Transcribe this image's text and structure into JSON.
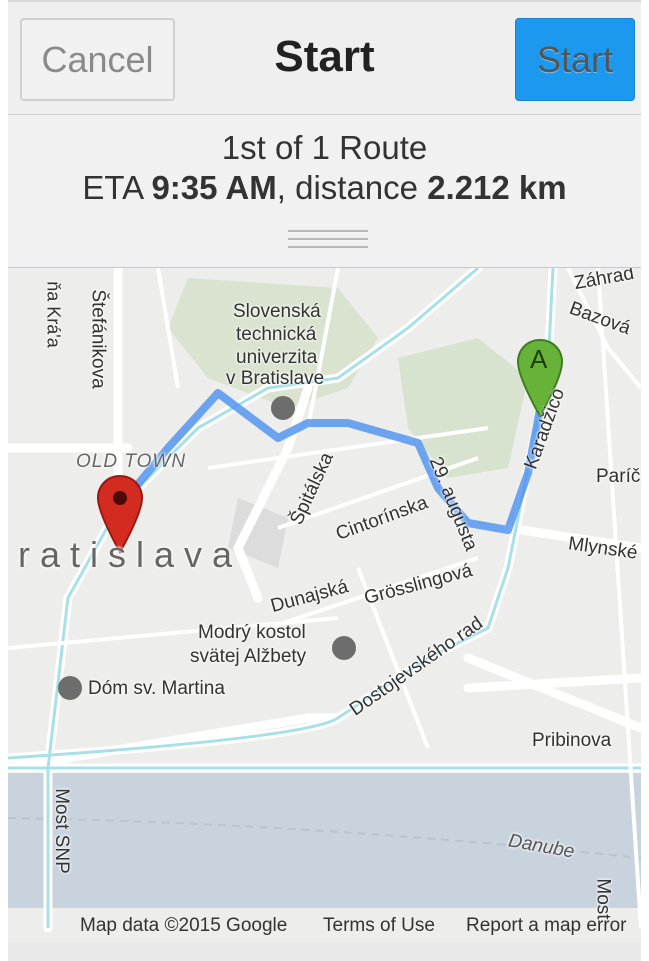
{
  "nav": {
    "cancel_label": "Cancel",
    "title": "Start",
    "start_label": "Start"
  },
  "route": {
    "count_text": "1st of 1 Route",
    "eta_prefix": "ETA ",
    "eta_value": "9:35 AM",
    "distance_prefix": ", distance ",
    "distance_value": "2.212 km"
  },
  "map": {
    "labels": {
      "stu": "Slovenská",
      "stu2": "technická",
      "stu3": "univerzita",
      "stu4": "v Bratislave",
      "old_town": "OLD TOWN",
      "bratislava": "ratislava",
      "stefanikova": "Štefánikova",
      "kraja": "ňa Krá'a",
      "spitalska": "Špitálska",
      "cintorinska": "Cintorínska",
      "augusta": "29. augusta",
      "karadzicova": "Karadžico",
      "dunajska": "Dunajská",
      "grosslingova": "Grösslingová",
      "modry": "Modrý kostol",
      "modry2": "svätej Alžbety",
      "dom": "Dóm sv. Martina",
      "dostojevskeho": "Dostojevského rad",
      "mlynske": "Mlynské",
      "pribinova": "Pribinova",
      "danube": "Danube",
      "most_snp": "Most SNP",
      "bazova": "Bazová",
      "paric": "Paríč",
      "zahrad": "Záhrad",
      "most": "Most",
      "marker_a": "A"
    },
    "colors": {
      "route": "#4a90f0",
      "road": "#ffffff",
      "water": "#cdd6e0",
      "park": "#d9e6c8",
      "marker_start": "#67b33a",
      "marker_end": "#d42b20"
    }
  },
  "footer": {
    "google": "Google",
    "map_data": "Map data ©2015 Google",
    "terms": "Terms of Use",
    "report": "Report a map error"
  }
}
